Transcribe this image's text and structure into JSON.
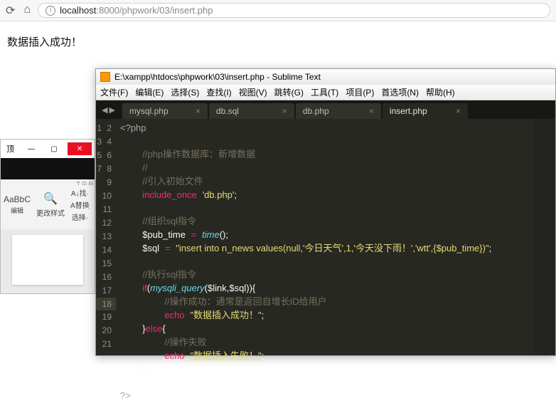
{
  "browser": {
    "url_host": "localhost",
    "url_port": ":8000",
    "url_path": "/phpwork/03/insert.php"
  },
  "page_message": "数据插入成功！",
  "sublime": {
    "title": "E:\\xampp\\htdocs\\phpwork\\03\\insert.php - Sublime Text",
    "menu": {
      "file": "文件(F)",
      "edit": "编辑(E)",
      "select": "选择(S)",
      "find": "查找(I)",
      "view": "视图(V)",
      "goto": "跳转(G)",
      "tools": "工具(T)",
      "project": "项目(P)",
      "prefs": "首选项(N)",
      "help": "帮助(H)"
    },
    "tabs": [
      {
        "label": "mysql.php"
      },
      {
        "label": "db.sql"
      },
      {
        "label": "db.php"
      },
      {
        "label": "insert.php"
      }
    ],
    "lines": [
      "1",
      "2",
      "3",
      "4",
      "5",
      "6",
      "7",
      "8",
      "9",
      "10",
      "11",
      "12",
      "13",
      "14",
      "15",
      "16",
      "17",
      "18",
      "19",
      "20",
      "21"
    ],
    "code": {
      "l1_open": "<?php",
      "l3_cmt": "//php操作数据库：新增数据",
      "l4_cmt": "//",
      "l5_cmt": "//引入初始文件",
      "l6_kw": "include_once",
      "l6_str": "'db.php'",
      "l8_cmt": "//组织sql指令",
      "l9_var": "$pub_time",
      "l9_fn": "time",
      "l10_var": "$sql",
      "l10_str": "\"insert into n_news values(null,'今日天气',1,'今天没下雨！','wtt',{$pub_time})\"",
      "l12_cmt": "//执行sql指令",
      "l13_if": "if",
      "l13_fn": "mysqli_query",
      "l13_a1": "$link",
      "l13_a2": "$sql",
      "l14_cmt": "//操作成功：通常是返回自增长ID给用户",
      "l15_kw": "echo",
      "l15_str": "\"数据插入成功！\"",
      "l16_else": "else",
      "l17_cmt": "//操作失败",
      "l18_kw": "echo",
      "l18_str": "\"数据插入失败！\"",
      "l21_close": "?>"
    }
  },
  "frag": {
    "tab_label": "顶",
    "style_sample": "AaBbC",
    "btn1": "A↓找·",
    "btn2": "更改样式",
    "btn3": "A替换",
    "btn4": "选择·",
    "group": "编辑"
  }
}
